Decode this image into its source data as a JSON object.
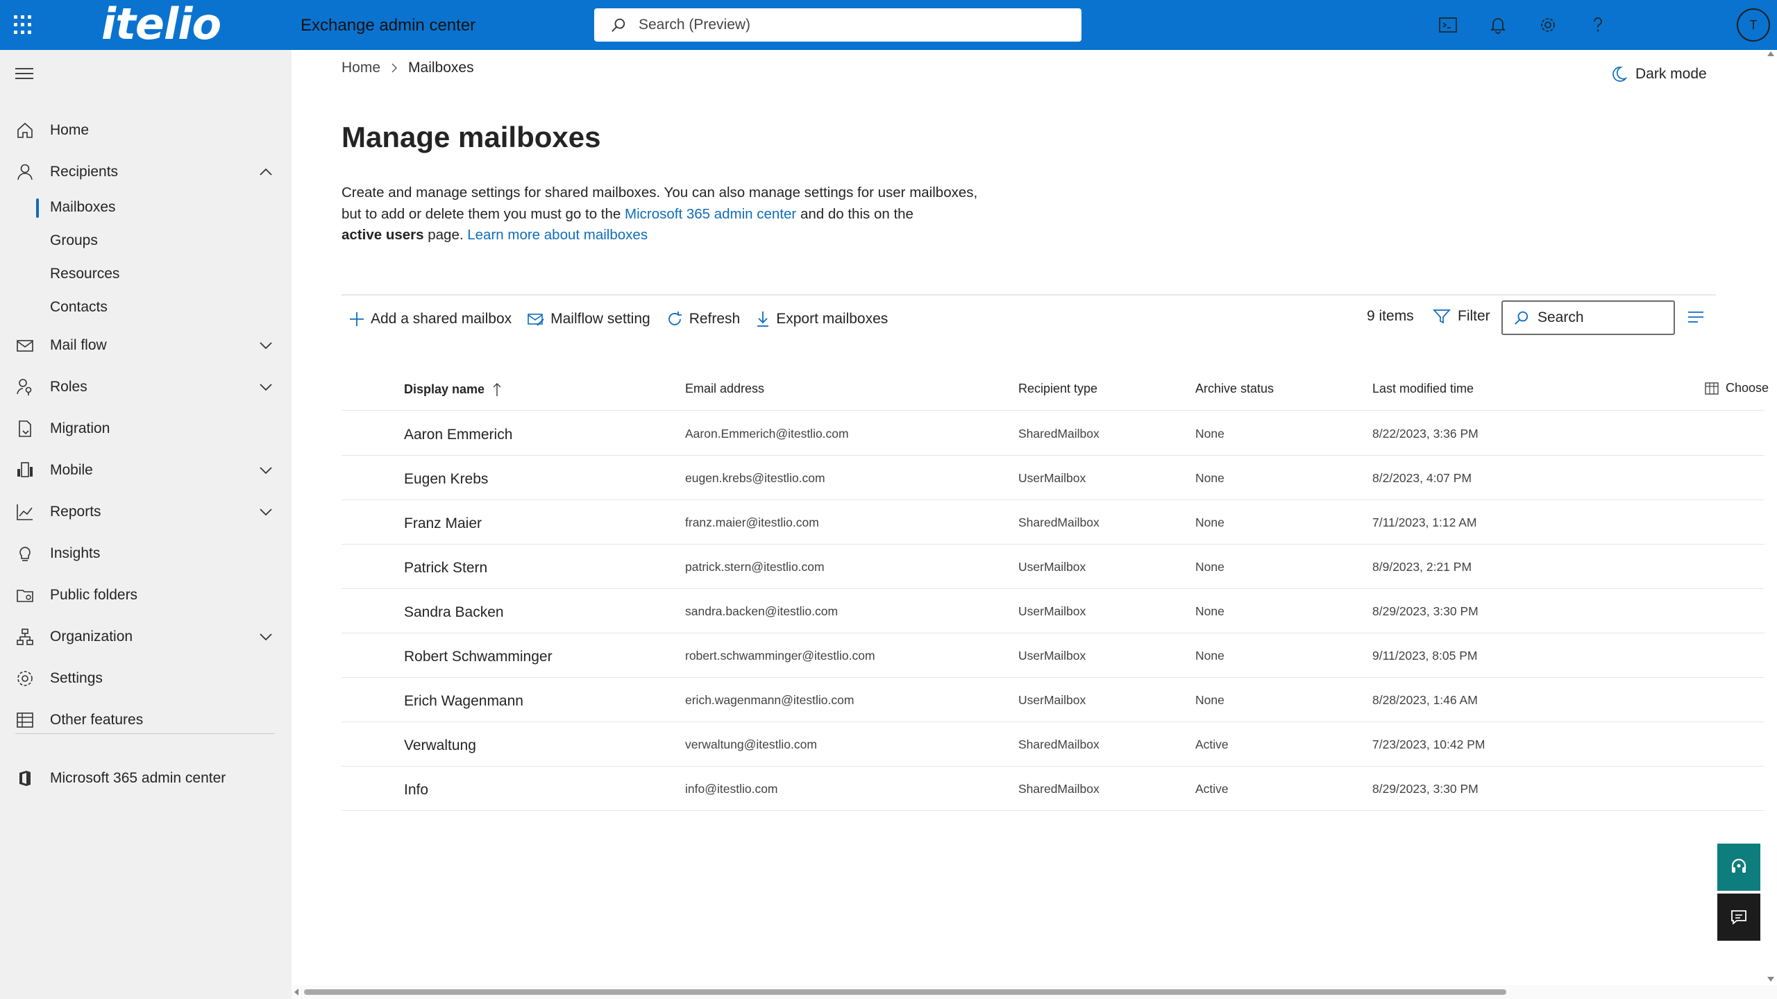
{
  "header": {
    "logo": "itelio",
    "app_title": "Exchange admin center",
    "search_placeholder": "Search (Preview)",
    "avatar_initial": "T",
    "icons": [
      "app-launcher-icon",
      "terminal-icon",
      "bell-icon",
      "gear-icon",
      "help-icon"
    ]
  },
  "sidebar": {
    "items": [
      {
        "label": "Home",
        "icon": "home-icon",
        "expandable": false
      },
      {
        "label": "Recipients",
        "icon": "person-icon",
        "expandable": true,
        "expanded": true
      },
      {
        "label": "Mail flow",
        "icon": "mail-icon",
        "expandable": true
      },
      {
        "label": "Roles",
        "icon": "person-key-icon",
        "expandable": true
      },
      {
        "label": "Migration",
        "icon": "document-arrow-icon",
        "expandable": false
      },
      {
        "label": "Mobile",
        "icon": "mobile-icon",
        "expandable": true
      },
      {
        "label": "Reports",
        "icon": "chart-line-icon",
        "expandable": true
      },
      {
        "label": "Insights",
        "icon": "lightbulb-icon",
        "expandable": false
      },
      {
        "label": "Public folders",
        "icon": "folder-icon",
        "expandable": false
      },
      {
        "label": "Organization",
        "icon": "org-chart-icon",
        "expandable": true
      },
      {
        "label": "Settings",
        "icon": "gear-icon",
        "expandable": false
      },
      {
        "label": "Other features",
        "icon": "table-icon",
        "expandable": false
      }
    ],
    "recipients_sub": [
      {
        "label": "Mailboxes",
        "selected": true
      },
      {
        "label": "Groups"
      },
      {
        "label": "Resources"
      },
      {
        "label": "Contacts"
      }
    ],
    "footer_item": {
      "label": "Microsoft 365 admin center",
      "icon": "office-icon"
    }
  },
  "breadcrumb": {
    "home": "Home",
    "current": "Mailboxes"
  },
  "dark_mode_label": "Dark mode",
  "page": {
    "title": "Manage mailboxes",
    "description": {
      "part1": "Create and manage settings for shared mailboxes. You can also manage settings for user mailboxes, but to add or delete them you must go to the",
      "link1": "Microsoft 365 admin center",
      "part2": "and do this on the",
      "bold": "active users",
      "part3": "page.",
      "link2": "Learn more about mailboxes"
    }
  },
  "toolbar": {
    "add_label": "Add a shared mailbox",
    "mailflow_label": "Mailflow setting",
    "refresh_label": "Refresh",
    "export_label": "Export mailboxes",
    "items_count": "9 items",
    "filter_label": "Filter",
    "search_placeholder": "Search"
  },
  "table": {
    "columns": [
      "Display name",
      "Email address",
      "Recipient type",
      "Archive status",
      "Last modified time"
    ],
    "sort_column": "Display name",
    "sort_direction": "ascending",
    "choose_columns_label": "Choose",
    "rows": [
      {
        "name": "Aaron Emmerich",
        "email": "Aaron.Emmerich@itestlio.com",
        "type": "SharedMailbox",
        "archive": "None",
        "modified": "8/22/2023, 3:36 PM"
      },
      {
        "name": "Eugen Krebs",
        "email": "eugen.krebs@itestlio.com",
        "type": "UserMailbox",
        "archive": "None",
        "modified": "8/2/2023, 4:07 PM"
      },
      {
        "name": "Franz Maier",
        "email": "franz.maier@itestlio.com",
        "type": "SharedMailbox",
        "archive": "None",
        "modified": "7/11/2023, 1:12 AM"
      },
      {
        "name": "Patrick Stern",
        "email": "patrick.stern@itestlio.com",
        "type": "UserMailbox",
        "archive": "None",
        "modified": "8/9/2023, 2:21 PM"
      },
      {
        "name": "Sandra Backen",
        "email": "sandra.backen@itestlio.com",
        "type": "UserMailbox",
        "archive": "None",
        "modified": "8/29/2023, 3:30 PM"
      },
      {
        "name": "Robert Schwamminger",
        "email": "robert.schwamminger@itestlio.com",
        "type": "UserMailbox",
        "archive": "None",
        "modified": "9/11/2023, 8:05 PM"
      },
      {
        "name": "Erich Wagenmann",
        "email": "erich.wagenmann@itestlio.com",
        "type": "UserMailbox",
        "archive": "None",
        "modified": "8/28/2023, 1:46 AM"
      },
      {
        "name": "Verwaltung",
        "email": "verwaltung@itestlio.com",
        "type": "SharedMailbox",
        "archive": "Active",
        "modified": "7/23/2023, 10:42 PM"
      },
      {
        "name": "Info",
        "email": "info@itestlio.com",
        "type": "SharedMailbox",
        "archive": "Active",
        "modified": "8/29/2023, 3:30 PM"
      }
    ]
  },
  "colors": {
    "brand_blue": "#0a73cf",
    "link": "#0f6cbd",
    "help_teal": "#0e7d7d",
    "sidebar_bg": "#f0f0f0"
  }
}
